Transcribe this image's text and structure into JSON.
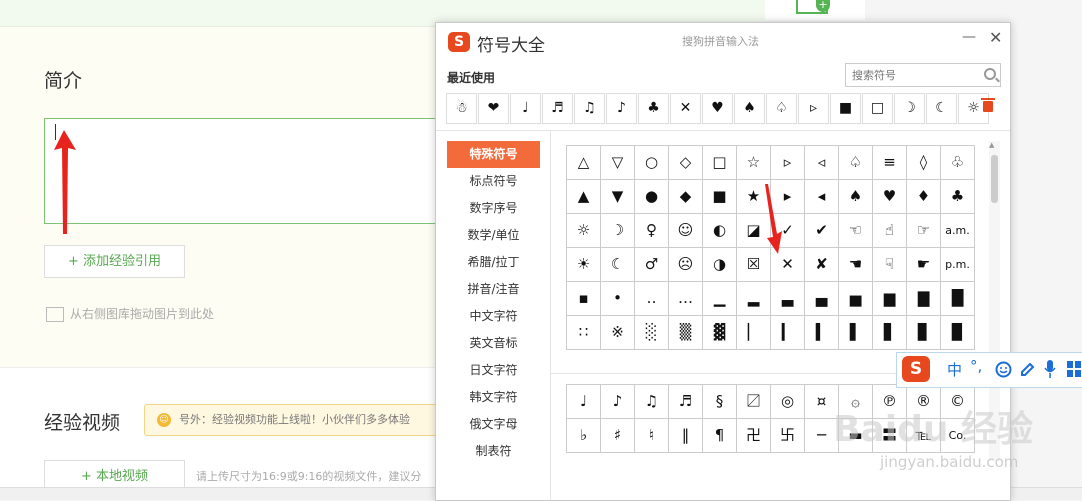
{
  "page": {
    "intro_title": "简介",
    "add_ref_button": "+ 添加经验引用",
    "drag_hint": "从右侧图库拖动图片到此处",
    "video_title": "经验视频",
    "notice_text": "号外：经验视频功能上线啦！小伙伴们多多体验",
    "local_video_button": "+ 本地视频",
    "upload_hint": "请上传尺寸为16:9或9:16的视频文件，建议分"
  },
  "dialog": {
    "logo": "S",
    "title": "符号大全",
    "subtitle": "搜狗拼音输入法",
    "minimize": "—",
    "close": "✕",
    "recent_label": "最近使用",
    "search_placeholder": "搜索符号",
    "recent": [
      "☃",
      "❤",
      "♩",
      "♬",
      "♫",
      "♪",
      "♣",
      "✕",
      "♥",
      "♠",
      "♤",
      "▹",
      "■",
      "□",
      "☽",
      "☾",
      "☼"
    ],
    "categories": [
      {
        "label": "特殊符号",
        "active": true
      },
      {
        "label": "标点符号",
        "active": false
      },
      {
        "label": "数字序号",
        "active": false
      },
      {
        "label": "数学/单位",
        "active": false
      },
      {
        "label": "希腊/拉丁",
        "active": false
      },
      {
        "label": "拼音/注音",
        "active": false
      },
      {
        "label": "中文字符",
        "active": false
      },
      {
        "label": "英文音标",
        "active": false
      },
      {
        "label": "日文字符",
        "active": false
      },
      {
        "label": "韩文字符",
        "active": false
      },
      {
        "label": "俄文字母",
        "active": false
      },
      {
        "label": "制表符",
        "active": false
      }
    ],
    "grid1": [
      "△",
      "▽",
      "○",
      "◇",
      "□",
      "☆",
      "▹",
      "◃",
      "♤",
      "≡",
      "◊",
      "♧",
      "▲",
      "▼",
      "●",
      "◆",
      "■",
      "★",
      "▸",
      "◂",
      "♠",
      "♥",
      "♦",
      "♣",
      "☼",
      "☽",
      "♀",
      "☺",
      "◐",
      "◪",
      "✓",
      "✔",
      "☜",
      "☝",
      "☞",
      "a.m.",
      "☀",
      "☾",
      "♂",
      "☹",
      "◑",
      "☒",
      "✕",
      "✘",
      "☚",
      "☟",
      "☛",
      "p.m.",
      "▪",
      "•",
      "‥",
      "…",
      "▁",
      "▂",
      "▃",
      "▄",
      "▅",
      "▆",
      "▇",
      "█",
      "∷",
      "※",
      "░",
      "▒",
      "▓",
      "▏",
      "▎",
      "▍",
      "▌",
      "▋",
      "▊",
      "▉"
    ],
    "grid2": [
      "♩",
      "♪",
      "♫",
      "♬",
      "§",
      "〼",
      "◎",
      "¤",
      "۞",
      "℗",
      "®",
      "©",
      "♭",
      "♯",
      "♮",
      "‖",
      "¶",
      "卍",
      "卐",
      "─",
      "▬",
      "〓",
      "℡",
      "Co."
    ]
  },
  "ime_bar": {
    "logo": "S",
    "lang": "中",
    "punct": "°,",
    "emoji_icon": "smiley-icon",
    "skin_icon": "pen-icon",
    "voice_icon": "microphone-icon",
    "grid_icon": "grid-icon"
  },
  "watermark": {
    "brand": "Baidu 经验",
    "url": "jingyan.baidu.com"
  }
}
